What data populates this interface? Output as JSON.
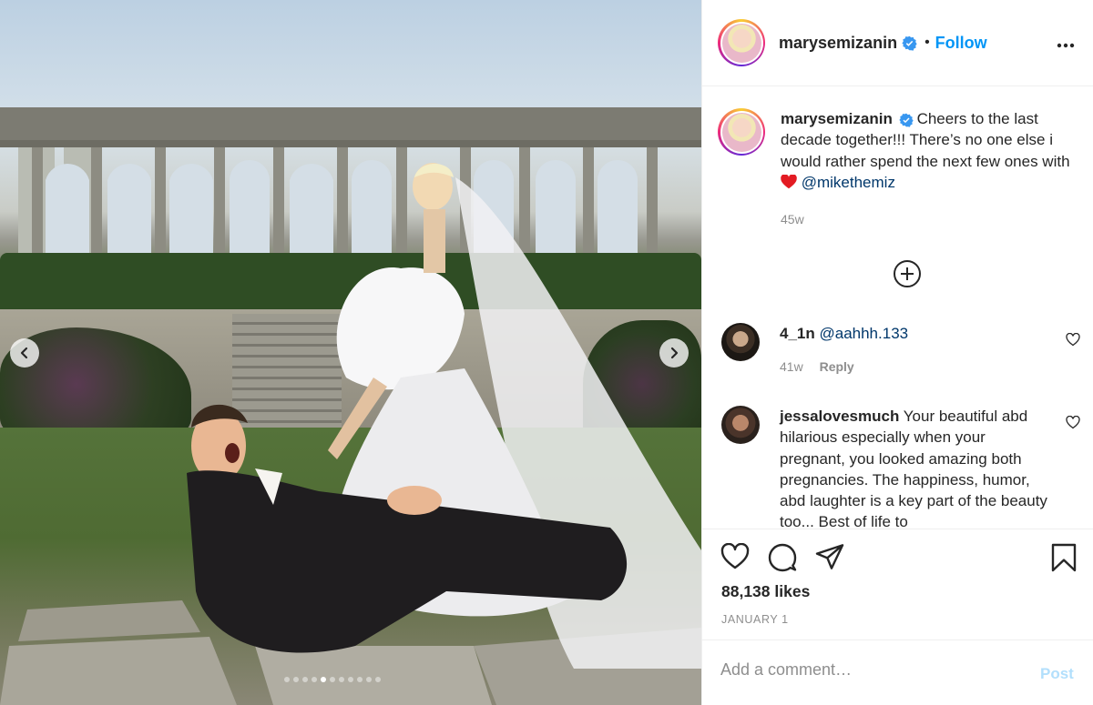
{
  "post": {
    "username": "marysemizanin",
    "follow_label": "Follow",
    "separator": "•",
    "caption_text": "Cheers to the last decade together!!! There’s no one else i would rather spend the next few ones with",
    "caption_mention": "@mikethemiz",
    "caption_time": "45w",
    "likes": "88,138 likes",
    "date": "JANUARY 1"
  },
  "carousel": {
    "slides": 11,
    "active_index": 4
  },
  "comments": [
    {
      "username": "4_1n",
      "text": "@aahhh.133",
      "time": "41w",
      "reply_label": "Reply"
    },
    {
      "username": "jessalovesmuch",
      "text": "Your beautiful abd hilarious especially when your pregnant, you looked amazing both pregnancies. The happiness, humor, abd laughter is a key part of the beauty too... Best of life to"
    }
  ],
  "add_comment": {
    "placeholder": "Add a comment…",
    "post_label": "Post"
  },
  "icons": {
    "prev": "chevron-left-icon",
    "next": "chevron-right-icon",
    "verified": "verified-badge-icon",
    "more": "more-options-icon",
    "load_more": "plus-circle-icon",
    "like": "heart-icon",
    "comment": "comment-icon",
    "share": "share-icon",
    "save": "bookmark-icon"
  },
  "colors": {
    "accent": "#0095f6",
    "verified": "#3897f0",
    "heart": "#ed4956",
    "post_disabled": "#b2dffc"
  }
}
